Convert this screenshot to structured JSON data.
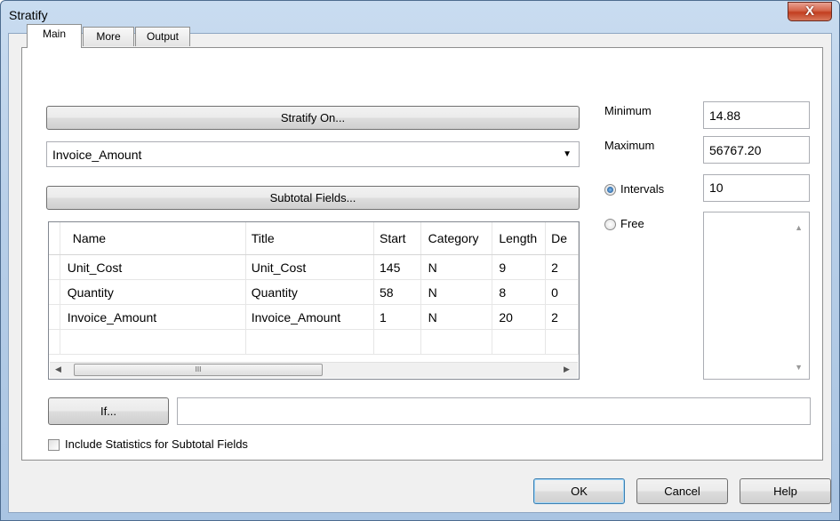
{
  "window": {
    "title": "Stratify",
    "close_glyph": "X"
  },
  "tabs": [
    {
      "label": "Main",
      "active": true
    },
    {
      "label": "More",
      "active": false
    },
    {
      "label": "Output",
      "active": false
    }
  ],
  "main": {
    "stratify_on_label": "Stratify On...",
    "field_select_value": "Invoice_Amount",
    "subtotal_fields_label": "Subtotal Fields...",
    "if_button_label": "If...",
    "if_expression_value": "",
    "include_stats_label": "Include Statistics for Subtotal Fields",
    "include_stats_checked": false
  },
  "fields_table": {
    "columns": [
      "Name",
      "Title",
      "Start",
      "Category",
      "Length",
      "De"
    ],
    "rows": [
      [
        "Unit_Cost",
        "Unit_Cost",
        "145",
        "N",
        "9",
        "2"
      ],
      [
        "Quantity",
        "Quantity",
        "58",
        "N",
        "8",
        "0"
      ],
      [
        "Invoice_Amount",
        "Invoice_Amount",
        "1",
        "N",
        "20",
        "2"
      ]
    ],
    "scroll_thumb_grip": "III"
  },
  "range": {
    "minimum_label": "Minimum",
    "minimum_value": "14.88",
    "maximum_label": "Maximum",
    "maximum_value": "56767.20",
    "intervals_label": "Intervals",
    "intervals_value": "10",
    "free_label": "Free",
    "selected_mode": "intervals"
  },
  "footer": {
    "ok_label": "OK",
    "cancel_label": "Cancel",
    "help_label": "Help"
  },
  "colors": {
    "title_bar": "#b8cfe8",
    "close_button": "#c94a2c",
    "radio_selected": "#1c5a9a"
  }
}
